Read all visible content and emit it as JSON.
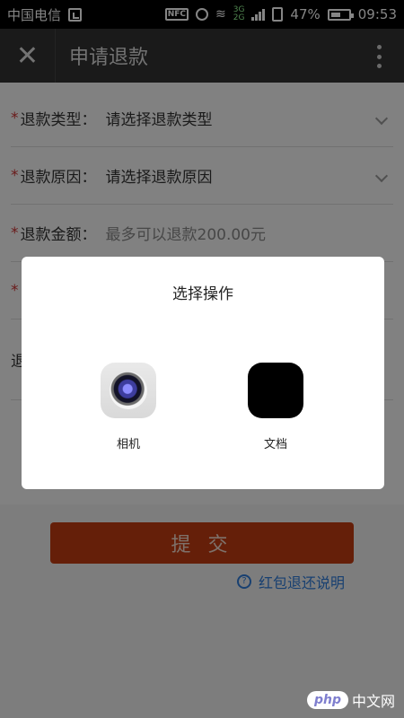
{
  "status_bar": {
    "carrier": "中国电信",
    "nfc": "NFC",
    "network_types": [
      "3G",
      "2G"
    ],
    "battery": "47%",
    "time": "09:53"
  },
  "app_bar": {
    "title": "申请退款",
    "close_icon": "close-icon",
    "more_icon": "more-vertical-icon"
  },
  "form": {
    "required_mark": "*",
    "refund_type": {
      "label": "退款类型：",
      "value": "请选择退款类型"
    },
    "refund_reason": {
      "label": "退款原因：",
      "value": "请选择退款原因"
    },
    "refund_amount": {
      "label": "退款金额：",
      "placeholder": "最多可以退款200.00元"
    },
    "partial_row_label": "退"
  },
  "actions": {
    "submit": "提 交",
    "help": "红包退还说明",
    "help_icon": "?"
  },
  "dialog": {
    "title": "选择操作",
    "options": [
      {
        "label": "相机",
        "icon": "camera-icon"
      },
      {
        "label": "文档",
        "icon": "document-icon"
      }
    ]
  },
  "watermark": {
    "logo": "php",
    "text": "中文网"
  },
  "colors": {
    "submit": "#c23c12",
    "link": "#2e7bd8",
    "header": "#333333"
  }
}
